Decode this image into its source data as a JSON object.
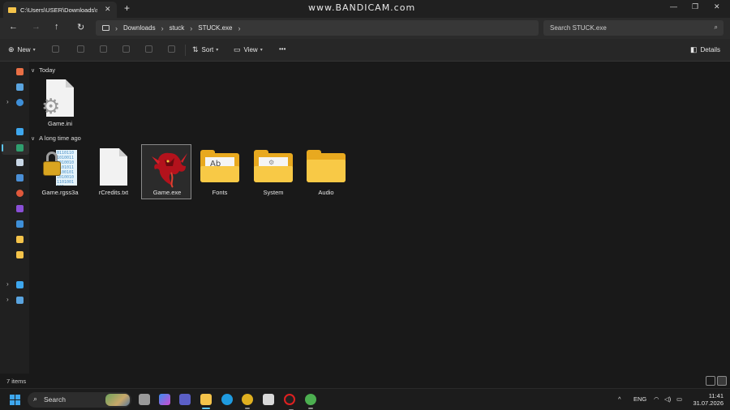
{
  "window": {
    "tab_title": "C:\\Users\\USER\\Downloads\\stu",
    "tab_close": "✕",
    "new_tab": "+",
    "watermark": "www.BANDICAM.com",
    "minimize": "—",
    "maximize": "❐",
    "close": "✕"
  },
  "address": {
    "back": "←",
    "forward": "→",
    "up": "↑",
    "refresh": "↻",
    "crumbs": [
      "Downloads",
      "stuck",
      "STUCK.exe"
    ],
    "separator": "›",
    "search_placeholder": "Search STUCK.exe",
    "search_icon": "⌕"
  },
  "toolbar": {
    "new_label": "New",
    "sort_label": "Sort",
    "view_label": "View",
    "more_label": "•••",
    "details_label": "Details"
  },
  "groups": {
    "today": "Today",
    "long_ago": "A long time ago"
  },
  "files": [
    {
      "name": "Game.ini",
      "icon": "settings-file-icon"
    },
    {
      "name": "Game.rgss3a",
      "icon": "locked-archive-icon"
    },
    {
      "name": "rCredits.txt",
      "icon": "text-file-icon"
    },
    {
      "name": "Game.exe",
      "icon": "dragon-exe-icon",
      "selected": true
    },
    {
      "name": "Fonts",
      "icon": "folder-icon"
    },
    {
      "name": "System",
      "icon": "folder-icon"
    },
    {
      "name": "Audio",
      "icon": "folder-icon"
    }
  ],
  "folder_paper_text": "Ab",
  "binary_text": "0110110101001110100101101011010010110100101101001101",
  "status": {
    "count": "7 items"
  },
  "taskbar": {
    "search_label": "Search",
    "search_icon": "⌕",
    "tray_up": "^",
    "lang": "ENG",
    "wifi": "◠",
    "volume": "◁)",
    "battery": "▭",
    "time": "11:41",
    "date": "31.07.2026"
  },
  "colors": {
    "accent": "#5cc5ef",
    "folder": "#f8c946",
    "background": "#191919"
  }
}
